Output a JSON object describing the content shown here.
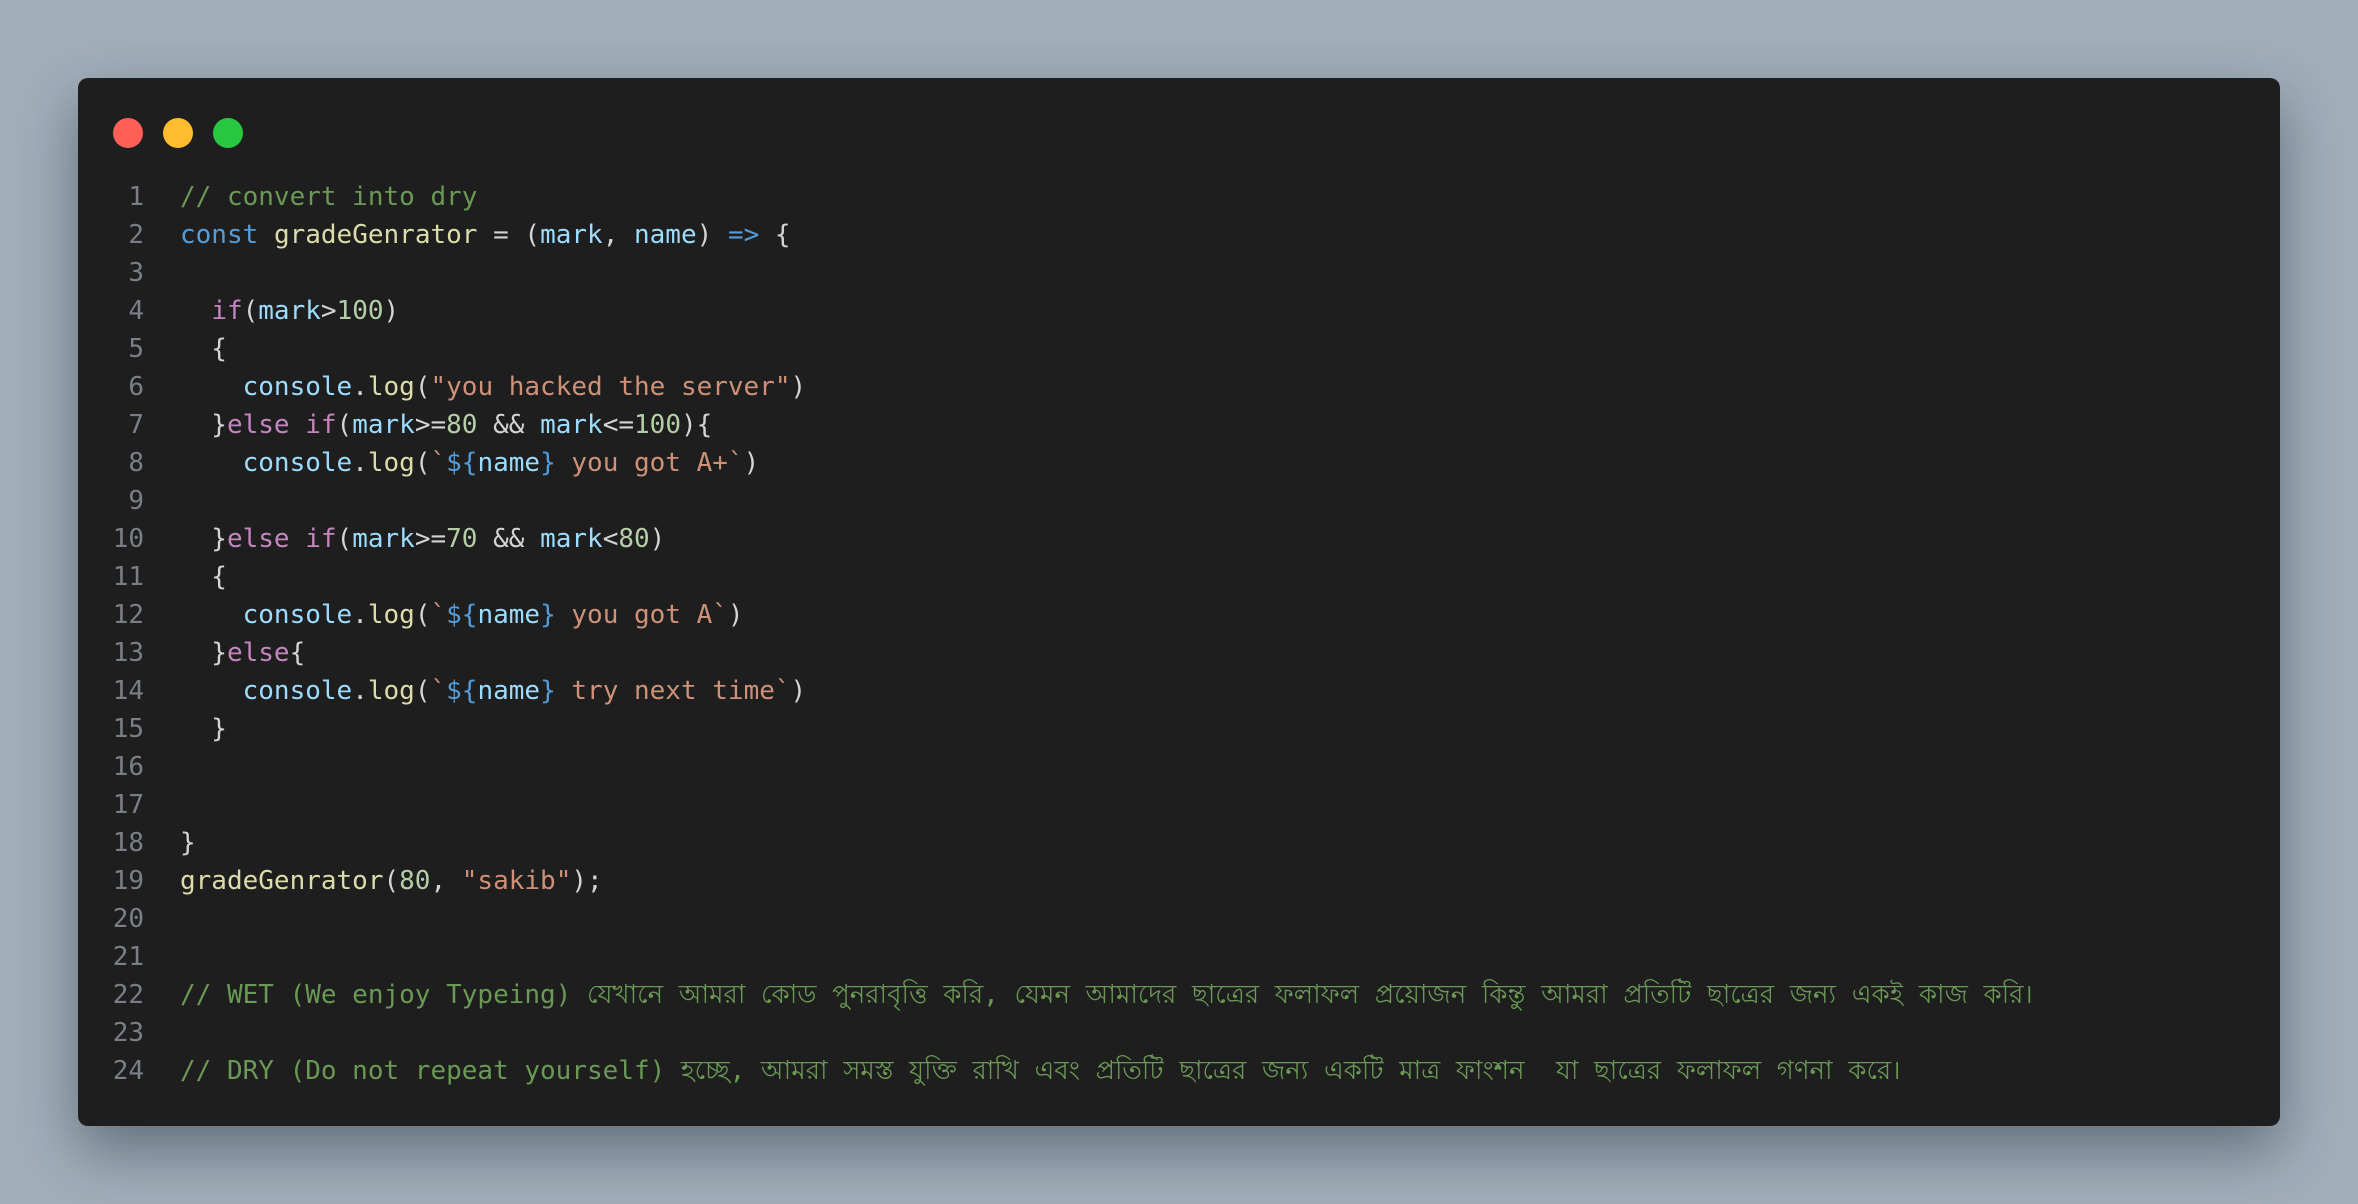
{
  "colors": {
    "background": "#a3aebb",
    "editor_bg": "#1e1e1e",
    "close": "#ff5f57",
    "minimize": "#febc2e",
    "maximize": "#28c840"
  },
  "window_controls": {
    "close_icon": "red-circle",
    "minimize_icon": "yellow-circle",
    "maximize_icon": "green-circle"
  },
  "code_lines": [
    {
      "n": "1",
      "tokens": [
        [
          "comment",
          "// convert into dry"
        ]
      ]
    },
    {
      "n": "2",
      "tokens": [
        [
          "kw",
          "const"
        ],
        [
          "punc",
          " "
        ],
        [
          "fn",
          "gradeGenrator"
        ],
        [
          "op",
          " = ("
        ],
        [
          "var",
          "mark"
        ],
        [
          "punc",
          ", "
        ],
        [
          "var",
          "name"
        ],
        [
          "punc",
          ") "
        ],
        [
          "arrow",
          "=>"
        ],
        [
          "punc",
          " {"
        ]
      ]
    },
    {
      "n": "3",
      "tokens": []
    },
    {
      "n": "4",
      "tokens": [
        [
          "punc",
          "  "
        ],
        [
          "ctrl",
          "if"
        ],
        [
          "punc",
          "("
        ],
        [
          "var",
          "mark"
        ],
        [
          "op",
          ">"
        ],
        [
          "num",
          "100"
        ],
        [
          "punc",
          ")"
        ]
      ]
    },
    {
      "n": "5",
      "tokens": [
        [
          "punc",
          "  {"
        ]
      ]
    },
    {
      "n": "6",
      "tokens": [
        [
          "punc",
          "    "
        ],
        [
          "var",
          "console"
        ],
        [
          "punc",
          "."
        ],
        [
          "fn",
          "log"
        ],
        [
          "punc",
          "("
        ],
        [
          "str",
          "\"you hacked the server\""
        ],
        [
          "punc",
          ")"
        ]
      ]
    },
    {
      "n": "7",
      "tokens": [
        [
          "punc",
          "  }"
        ],
        [
          "ctrl",
          "else if"
        ],
        [
          "punc",
          "("
        ],
        [
          "var",
          "mark"
        ],
        [
          "op",
          ">="
        ],
        [
          "num",
          "80"
        ],
        [
          "op",
          " && "
        ],
        [
          "var",
          "mark"
        ],
        [
          "op",
          "<="
        ],
        [
          "num",
          "100"
        ],
        [
          "punc",
          "){"
        ]
      ]
    },
    {
      "n": "8",
      "tokens": [
        [
          "punc",
          "    "
        ],
        [
          "var",
          "console"
        ],
        [
          "punc",
          "."
        ],
        [
          "fn",
          "log"
        ],
        [
          "punc",
          "("
        ],
        [
          "str",
          "`"
        ],
        [
          "interp",
          "${"
        ],
        [
          "var",
          "name"
        ],
        [
          "interp",
          "}"
        ],
        [
          "str",
          " you got A+`"
        ],
        [
          "punc",
          ")"
        ]
      ]
    },
    {
      "n": "9",
      "tokens": []
    },
    {
      "n": "10",
      "tokens": [
        [
          "punc",
          "  }"
        ],
        [
          "ctrl",
          "else if"
        ],
        [
          "punc",
          "("
        ],
        [
          "var",
          "mark"
        ],
        [
          "op",
          ">="
        ],
        [
          "num",
          "70"
        ],
        [
          "op",
          " && "
        ],
        [
          "var",
          "mark"
        ],
        [
          "op",
          "<"
        ],
        [
          "num",
          "80"
        ],
        [
          "punc",
          ")"
        ]
      ]
    },
    {
      "n": "11",
      "tokens": [
        [
          "punc",
          "  {"
        ]
      ]
    },
    {
      "n": "12",
      "tokens": [
        [
          "punc",
          "    "
        ],
        [
          "var",
          "console"
        ],
        [
          "punc",
          "."
        ],
        [
          "fn",
          "log"
        ],
        [
          "punc",
          "("
        ],
        [
          "str",
          "`"
        ],
        [
          "interp",
          "${"
        ],
        [
          "var",
          "name"
        ],
        [
          "interp",
          "}"
        ],
        [
          "str",
          " you got A`"
        ],
        [
          "punc",
          ")"
        ]
      ]
    },
    {
      "n": "13",
      "tokens": [
        [
          "punc",
          "  }"
        ],
        [
          "ctrl",
          "else"
        ],
        [
          "punc",
          "{"
        ]
      ]
    },
    {
      "n": "14",
      "tokens": [
        [
          "punc",
          "    "
        ],
        [
          "var",
          "console"
        ],
        [
          "punc",
          "."
        ],
        [
          "fn",
          "log"
        ],
        [
          "punc",
          "("
        ],
        [
          "str",
          "`"
        ],
        [
          "interp",
          "${"
        ],
        [
          "var",
          "name"
        ],
        [
          "interp",
          "}"
        ],
        [
          "str",
          " try next time`"
        ],
        [
          "punc",
          ")"
        ]
      ]
    },
    {
      "n": "15",
      "tokens": [
        [
          "punc",
          "  }"
        ]
      ]
    },
    {
      "n": "16",
      "tokens": []
    },
    {
      "n": "17",
      "tokens": []
    },
    {
      "n": "18",
      "tokens": [
        [
          "punc",
          "}"
        ]
      ]
    },
    {
      "n": "19",
      "tokens": [
        [
          "fn",
          "gradeGenrator"
        ],
        [
          "punc",
          "("
        ],
        [
          "num",
          "80"
        ],
        [
          "punc",
          ", "
        ],
        [
          "str",
          "\"sakib\""
        ],
        [
          "punc",
          ");"
        ]
      ]
    },
    {
      "n": "20",
      "tokens": []
    },
    {
      "n": "21",
      "tokens": []
    },
    {
      "n": "22",
      "tokens": [
        [
          "comment",
          "// WET (We enjoy Typeing) যেখানে আমরা কোড পুনরাবৃত্তি করি, যেমন আমাদের ছাত্রের ফলাফল প্রয়োজন কিন্তু আমরা প্রতিটি ছাত্রের জন্য একই কাজ করি।"
        ]
      ]
    },
    {
      "n": "23",
      "tokens": []
    },
    {
      "n": "24",
      "tokens": [
        [
          "comment",
          "// DRY (Do not repeat yourself) হচ্ছে, আমরা সমস্ত যুক্তি রাখি এবং প্রতিটি ছাত্রের জন্য একটি মাত্র ফাংশন  যা ছাত্রের ফলাফল গণনা করে।"
        ]
      ]
    }
  ]
}
